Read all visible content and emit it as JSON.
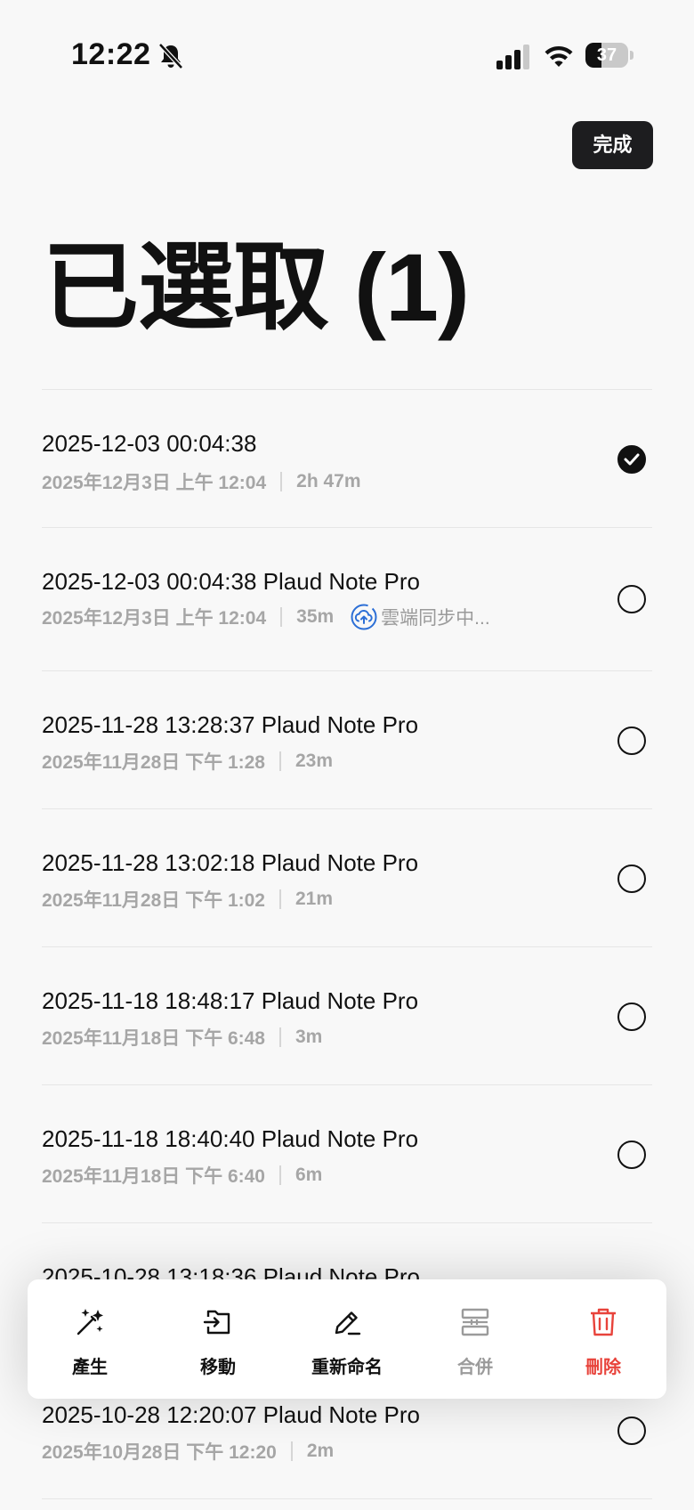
{
  "status_bar": {
    "time": "12:22",
    "battery": "37",
    "battery_level": 0.37
  },
  "header": {
    "done_label": "完成",
    "title": "已選取 (1)"
  },
  "recordings": [
    {
      "title": "2025-12-03 00:04:38",
      "date": "2025年12月3日 上午 12:04",
      "duration": "2h 47m",
      "selected": true
    },
    {
      "title": "2025-12-03 00:04:38 Plaud Note Pro",
      "date": "2025年12月3日 上午 12:04",
      "duration": "35m",
      "sync": "雲端同步中...",
      "selected": false
    },
    {
      "title": "2025-11-28 13:28:37 Plaud Note Pro",
      "date": "2025年11月28日 下午 1:28",
      "duration": "23m",
      "selected": false
    },
    {
      "title": "2025-11-28 13:02:18 Plaud Note Pro",
      "date": "2025年11月28日 下午 1:02",
      "duration": "21m",
      "selected": false
    },
    {
      "title": "2025-11-18 18:48:17 Plaud Note Pro",
      "date": "2025年11月18日 下午 6:48",
      "duration": "3m",
      "selected": false
    },
    {
      "title": "2025-11-18 18:40:40 Plaud Note Pro",
      "date": "2025年11月18日 下午 6:40",
      "duration": "6m",
      "selected": false
    },
    {
      "title": "2025-10-28 13:18:36 Plaud Note Pro",
      "selected": false
    },
    {
      "title": "2025-10-28 12:20:07 Plaud Note Pro",
      "date": "2025年10月28日 下午 12:20",
      "duration": "2m",
      "selected": false
    }
  ],
  "actions": [
    {
      "label": "產生",
      "icon": "magic-wand-icon"
    },
    {
      "label": "移動",
      "icon": "move-folder-icon"
    },
    {
      "label": "重新命名",
      "icon": "pencil-icon"
    },
    {
      "label": "合併",
      "icon": "merge-icon",
      "disabled": true
    },
    {
      "label": "刪除",
      "icon": "trash-icon",
      "danger": true
    }
  ],
  "colors": {
    "danger": "#e8433b",
    "sync_blue": "#2c6fd6",
    "meta_gray": "#a6a6a6"
  }
}
